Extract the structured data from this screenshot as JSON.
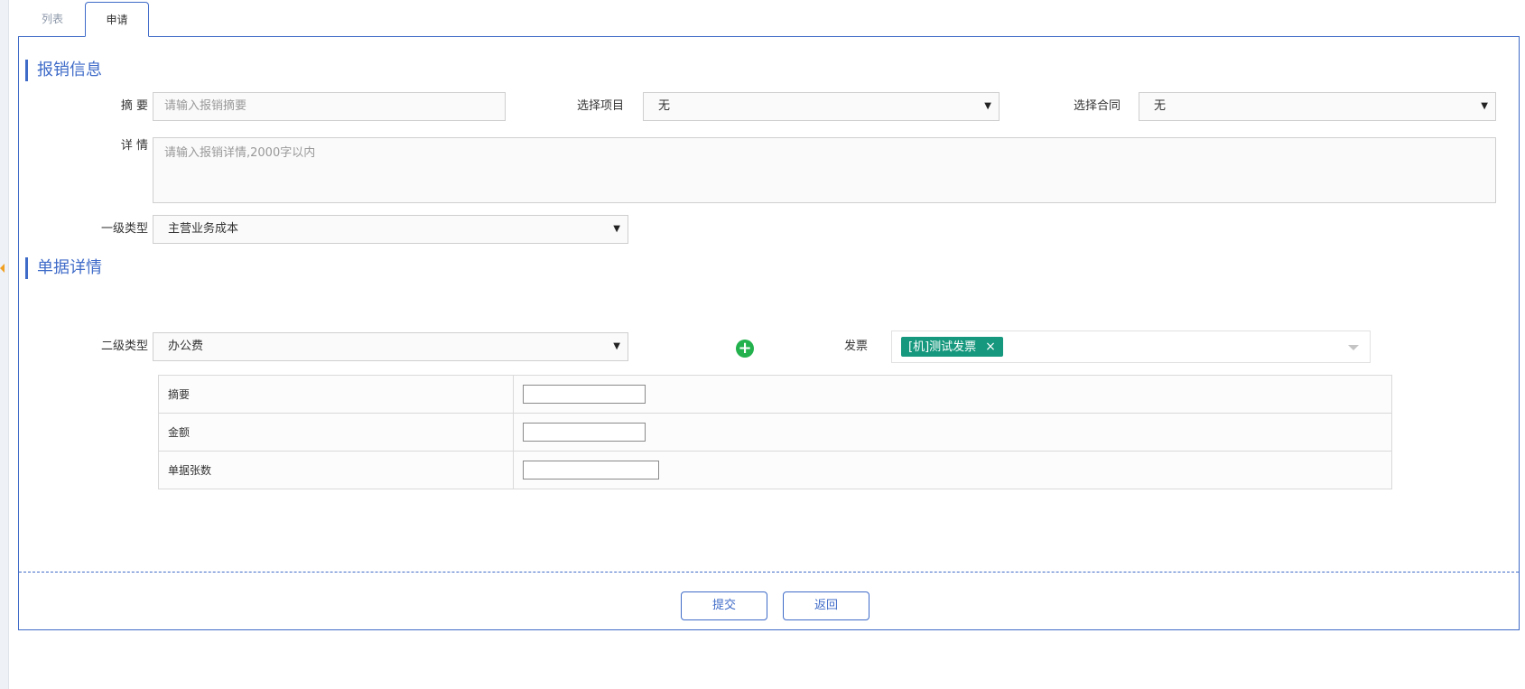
{
  "tabs": [
    {
      "label": "列表"
    },
    {
      "label": "申请"
    }
  ],
  "reimbursement_section": {
    "title": "报销信息",
    "summary": {
      "label": "摘 要",
      "placeholder": "请输入报销摘要"
    },
    "project": {
      "label": "选择项目",
      "value": "无"
    },
    "contract": {
      "label": "选择合同",
      "value": "无"
    },
    "details": {
      "label": "详 情",
      "placeholder": "请输入报销详情,2000字以内"
    },
    "primary_type": {
      "label": "一级类型",
      "value": "主营业务成本"
    }
  },
  "bill_section": {
    "title": "单据详情",
    "secondary_type": {
      "label": "二级类型",
      "value": "办公费"
    },
    "invoice": {
      "label": "发票",
      "tags": [
        "[机]测试发票"
      ]
    },
    "rows": [
      {
        "label": "摘要"
      },
      {
        "label": "金额"
      },
      {
        "label": "单据张数"
      }
    ]
  },
  "actions": {
    "submit": "提交",
    "back": "返回"
  },
  "colors": {
    "accent": "#3f6bc8",
    "tag_bg": "#16987e",
    "add_green": "#22b14c"
  }
}
